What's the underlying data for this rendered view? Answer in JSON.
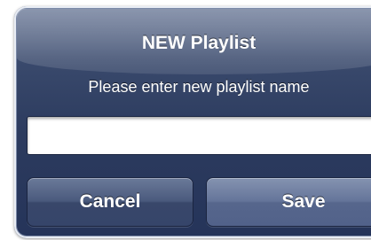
{
  "dialog": {
    "title": "NEW Playlist",
    "message": "Please enter new playlist name",
    "input": {
      "value": "",
      "placeholder": ""
    },
    "buttons": {
      "cancel_label": "Cancel",
      "save_label": "Save"
    }
  }
}
